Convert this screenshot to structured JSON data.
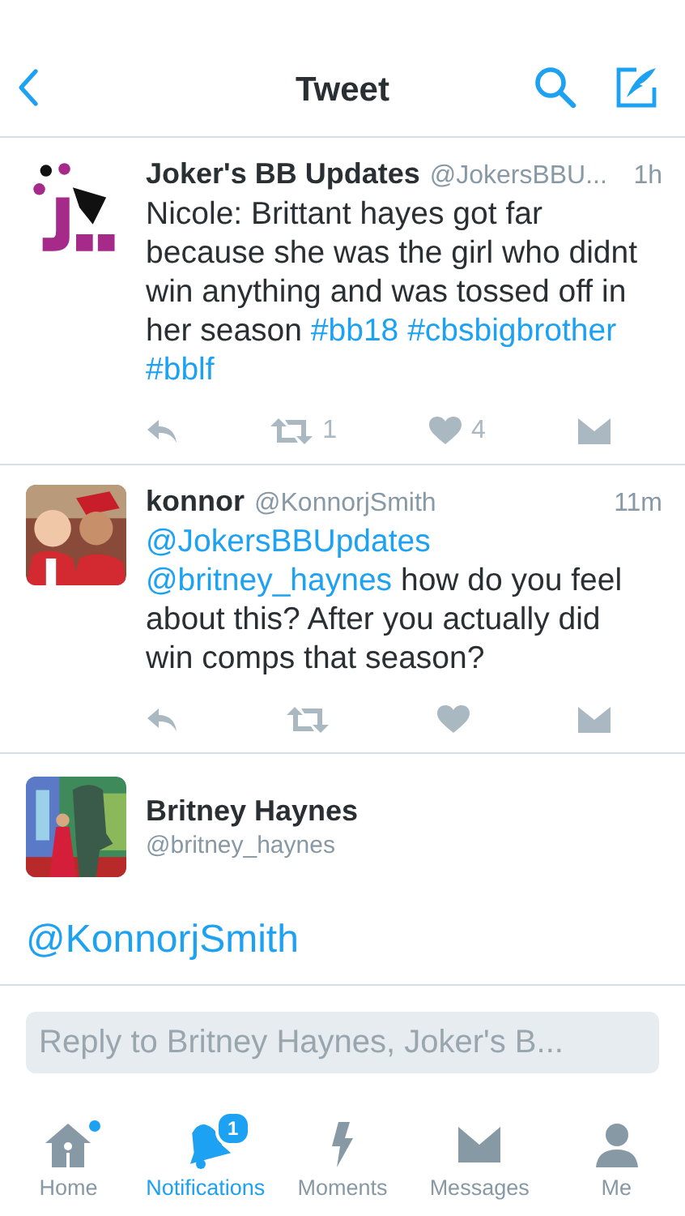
{
  "header": {
    "title": "Tweet"
  },
  "tweets": [
    {
      "avatar": {
        "kind": "logo"
      },
      "author": "Joker's BB Updates",
      "handle": "@JokersBBU...",
      "time": "1h",
      "segments": [
        {
          "kind": "plain",
          "text": "Nicole: Brittant hayes got far because she was the girl who didnt win anything and was tossed off in her season"
        },
        {
          "kind": "hashtag",
          "text": "#bb18"
        },
        {
          "kind": "hashtag",
          "text": "#cbsbigbrother"
        },
        {
          "kind": "hashtag",
          "text": "#bblf"
        }
      ],
      "retweets": "1",
      "likes": "4"
    },
    {
      "avatar": {
        "kind": "picture"
      },
      "author": "konnor",
      "handle": "@KonnorjSmith",
      "time": "11m",
      "segments": [
        {
          "kind": "mention",
          "text": "@JokersBBUpdates"
        },
        {
          "kind": "mention",
          "text": "@britney_haynes"
        },
        {
          "kind": "plain",
          "text": "how do you feel about this? After you actually did win comps that season?"
        }
      ]
    }
  ],
  "focused": {
    "author": "Britney Haynes",
    "handle": "@britney_haynes",
    "segments": [
      {
        "kind": "mention",
        "text": "@KonnorjSmith"
      }
    ]
  },
  "reply": {
    "placeholder": "Reply to Britney Haynes, Joker's B..."
  },
  "tabs": [
    {
      "kind": "home",
      "label": "Home",
      "selected": false,
      "dot": true
    },
    {
      "kind": "notifications",
      "label": "Notifications",
      "selected": true,
      "badge": "1"
    },
    {
      "kind": "moments",
      "label": "Moments",
      "selected": false
    },
    {
      "kind": "messages",
      "label": "Messages",
      "selected": false
    },
    {
      "kind": "me",
      "label": "Me",
      "selected": false
    }
  ]
}
